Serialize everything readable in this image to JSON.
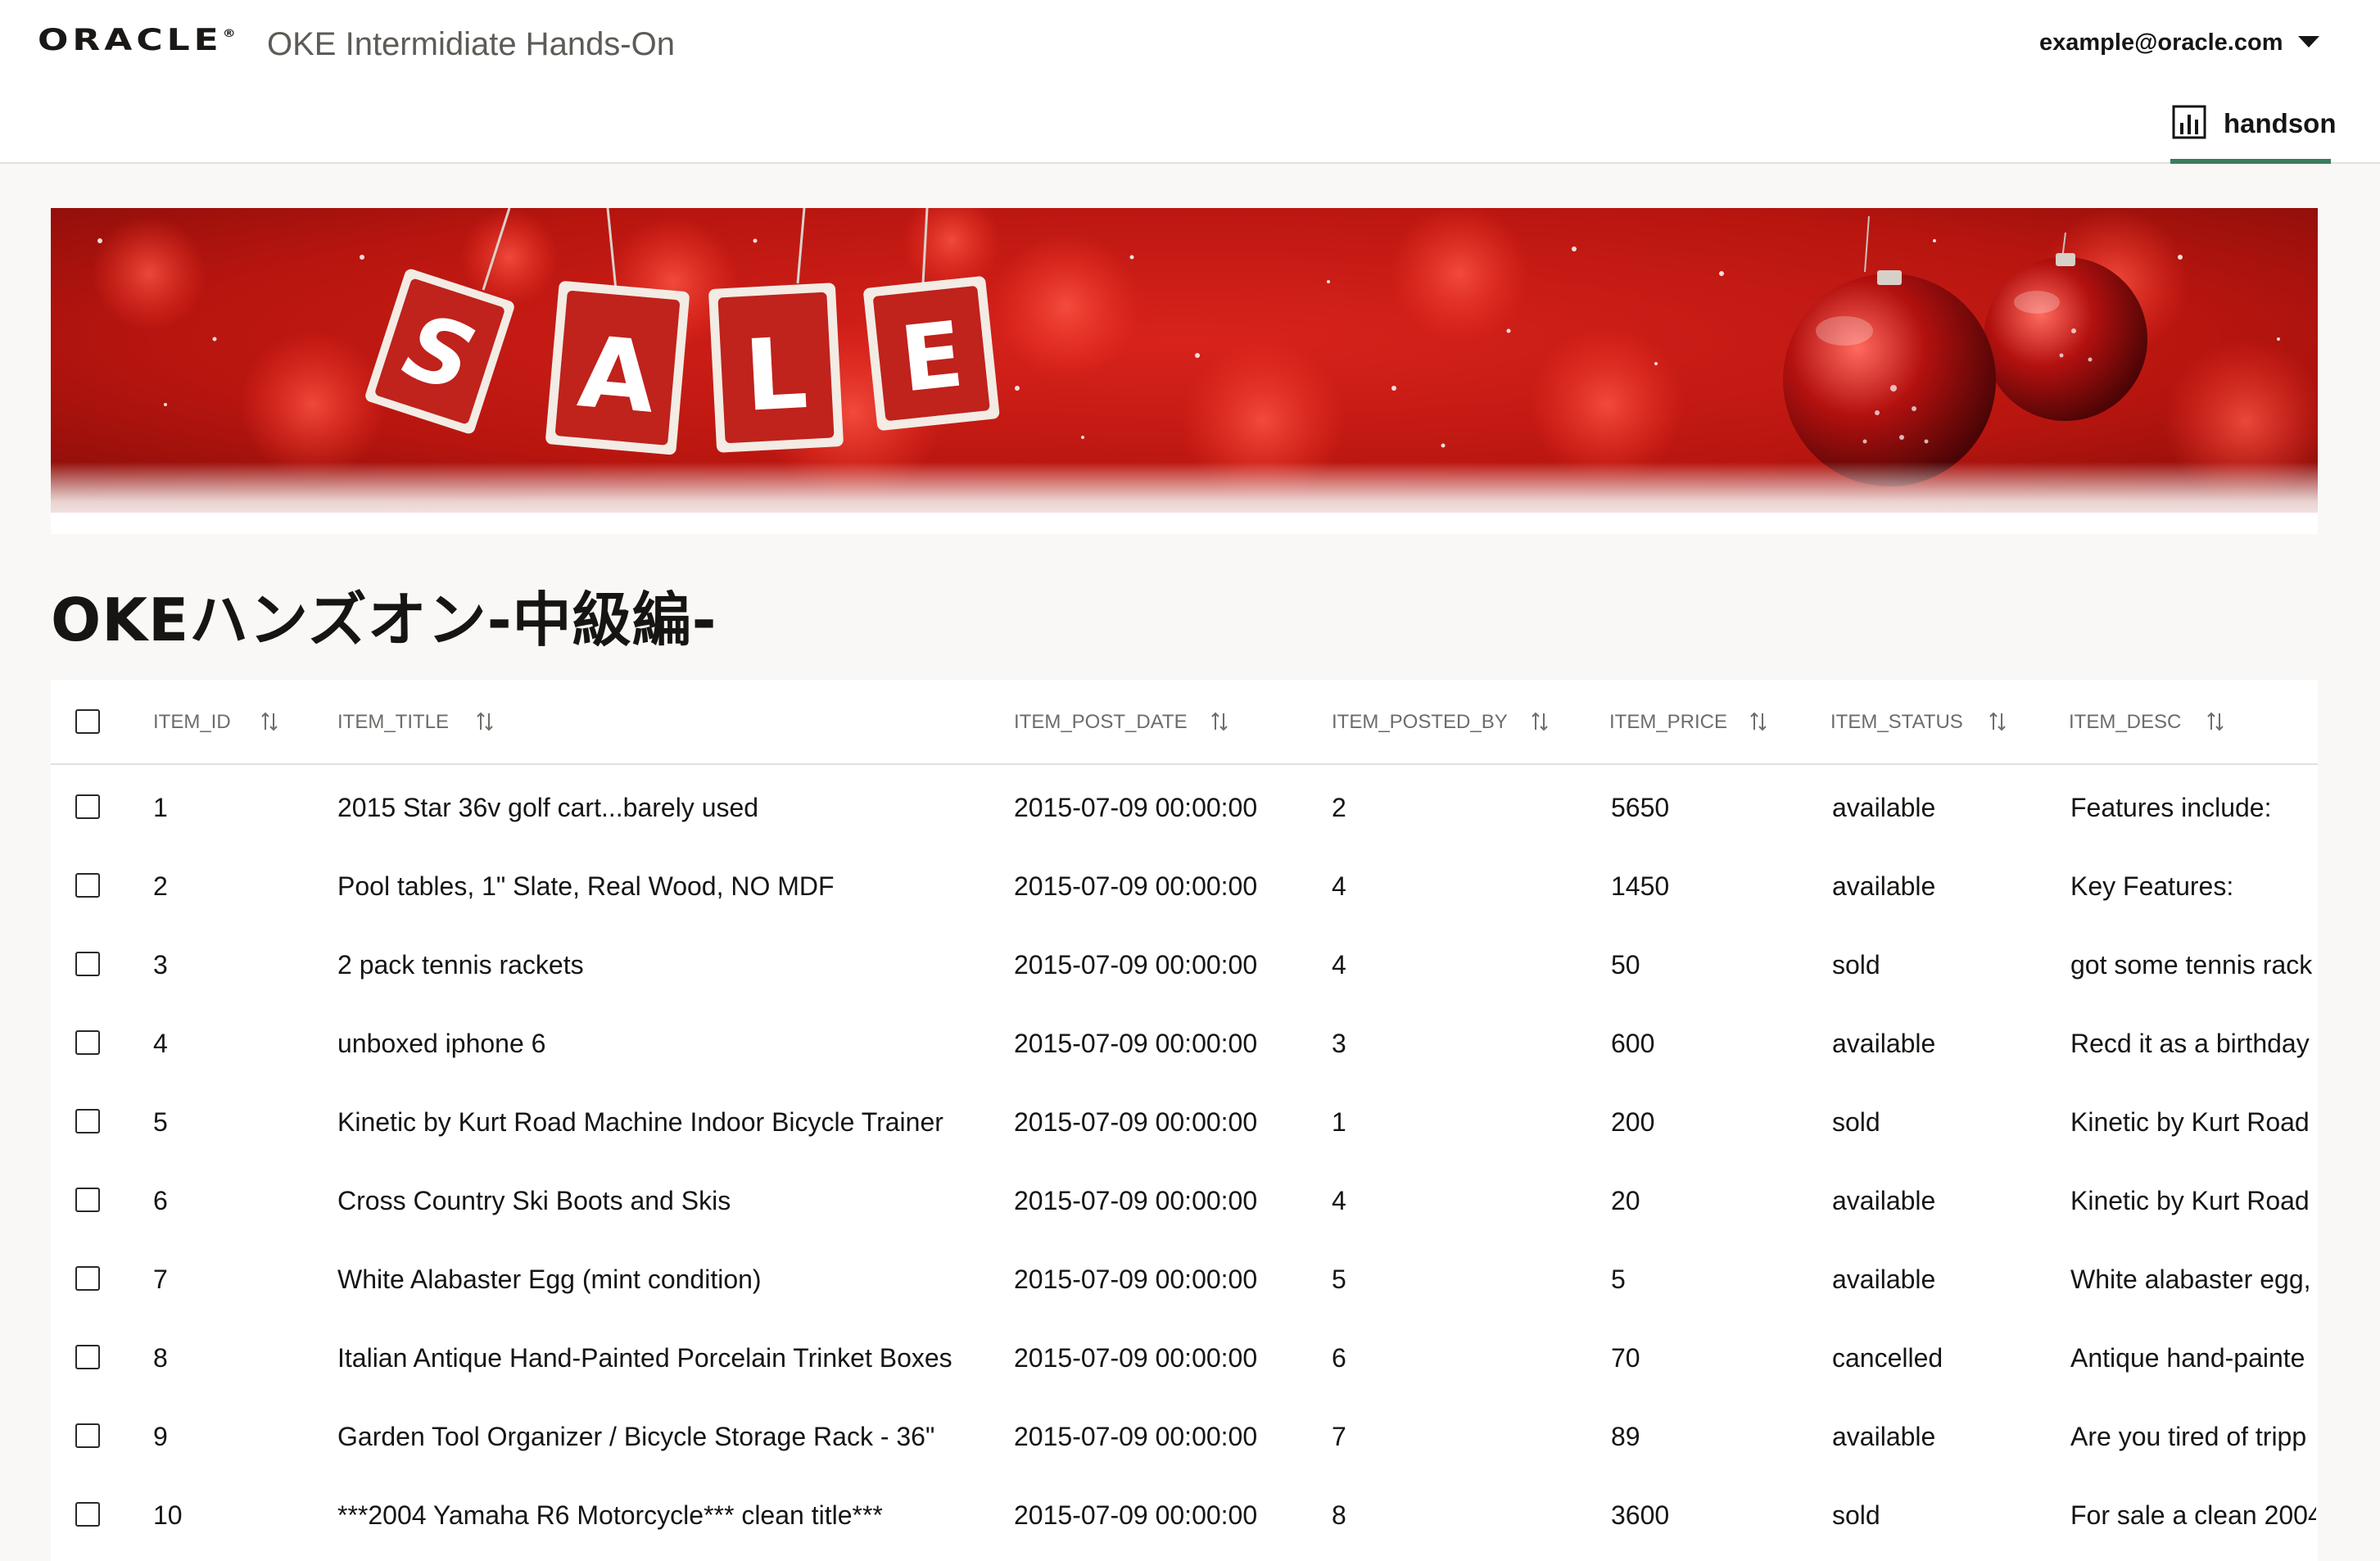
{
  "header": {
    "logo_text": "ORACLE",
    "logo_mark": "®",
    "app_title": "OKE Intermidiate Hands-On",
    "user_email": "example@oracle.com",
    "user_menu_icon": "caret-down-icon",
    "nav_tab": {
      "label": "handson",
      "icon": "bar-chart-icon",
      "active": true
    }
  },
  "banner": {
    "sale_letters": [
      "S",
      "A",
      "L",
      "E"
    ],
    "theme": "christmas-sale",
    "colors": {
      "background": "#c41a14",
      "tag": "#c0221c",
      "tag_border": "#f2ece4",
      "ornament": "#9e0f10"
    }
  },
  "page_title": "OKEハンズオン-中級編-",
  "table": {
    "columns": [
      "ITEM_ID",
      "ITEM_TITLE",
      "ITEM_POST_DATE",
      "ITEM_POSTED_BY",
      "ITEM_PRICE",
      "ITEM_STATUS",
      "ITEM_DESC"
    ],
    "sort_icon": "sort-arrows-icon",
    "rows": [
      {
        "id": "1",
        "title": "2015 Star 36v golf cart...barely used",
        "post_date": "2015-07-09 00:00:00",
        "posted_by": "2",
        "price": "5650",
        "status": "available",
        "desc": "Features include:"
      },
      {
        "id": "2",
        "title": "Pool tables, 1\" Slate, Real Wood, NO MDF",
        "post_date": "2015-07-09 00:00:00",
        "posted_by": "4",
        "price": "1450",
        "status": "available",
        "desc": "Key Features:"
      },
      {
        "id": "3",
        "title": "2 pack tennis rackets",
        "post_date": "2015-07-09 00:00:00",
        "posted_by": "4",
        "price": "50",
        "status": "sold",
        "desc": "got some tennis rack"
      },
      {
        "id": "4",
        "title": "unboxed iphone 6",
        "post_date": "2015-07-09 00:00:00",
        "posted_by": "3",
        "price": "600",
        "status": "available",
        "desc": "Recd it as a birthday"
      },
      {
        "id": "5",
        "title": "Kinetic by Kurt Road Machine Indoor Bicycle Trainer",
        "post_date": "2015-07-09 00:00:00",
        "posted_by": "1",
        "price": "200",
        "status": "sold",
        "desc": "Kinetic by Kurt Road"
      },
      {
        "id": "6",
        "title": "Cross Country Ski Boots and Skis",
        "post_date": "2015-07-09 00:00:00",
        "posted_by": "4",
        "price": "20",
        "status": "available",
        "desc": "Kinetic by Kurt Road"
      },
      {
        "id": "7",
        "title": "White Alabaster Egg (mint condition)",
        "post_date": "2015-07-09 00:00:00",
        "posted_by": "5",
        "price": "5",
        "status": "available",
        "desc": "White alabaster egg,"
      },
      {
        "id": "8",
        "title": "Italian Antique Hand-Painted Porcelain Trinket Boxes",
        "post_date": "2015-07-09 00:00:00",
        "posted_by": "6",
        "price": "70",
        "status": "cancelled",
        "desc": "Antique hand-painte"
      },
      {
        "id": "9",
        "title": "Garden Tool Organizer / Bicycle Storage Rack - 36\"",
        "post_date": "2015-07-09 00:00:00",
        "posted_by": "7",
        "price": "89",
        "status": "available",
        "desc": "Are you tired of tripp"
      },
      {
        "id": "10",
        "title": "***2004 Yamaha R6 Motorcycle*** clean title***",
        "post_date": "2015-07-09 00:00:00",
        "posted_by": "8",
        "price": "3600",
        "status": "sold",
        "desc": "For sale a clean 2004"
      }
    ]
  },
  "colors": {
    "accent": "#3a7d5c",
    "page_bg": "#f9f8f6",
    "text": "#161513",
    "muted": "#6f6c68"
  }
}
